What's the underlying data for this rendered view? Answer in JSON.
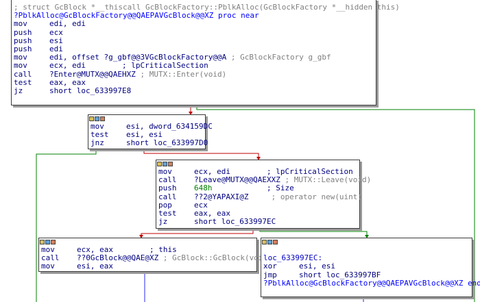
{
  "colors": {
    "edge_green": "#008000",
    "edge_red": "#c00000",
    "edge_blue": "#2a2af0",
    "node_border": "#3a3a3a"
  },
  "icons": [
    "color-icon",
    "graph-icon",
    "list-icon"
  ],
  "block1": {
    "header_comment": "; struct GcBlock *__thiscall GcBlockFactory::PblkAlloc(GcBlockFactory *__hidden this)",
    "proc_line": "?PblkAlloc@GcBlockFactory@@QAEPAVGcBlock@@XZ proc near",
    "lines": [
      {
        "m": "mov",
        "o": "edi, edi",
        "c": ""
      },
      {
        "m": "push",
        "o": "ecx",
        "c": ""
      },
      {
        "m": "push",
        "o": "esi",
        "c": ""
      },
      {
        "m": "push",
        "o": "edi",
        "c": ""
      },
      {
        "m": "mov",
        "o": "edi, offset ?g_gbf@@3VGcBlockFactory@@A",
        "c": " ; GcBlockFactory g_gbf"
      },
      {
        "m": "mov",
        "o": "ecx, edi        ; lpCriticalSection",
        "c": ""
      },
      {
        "m": "call",
        "o": "?Enter@MUTX@@QAEHXZ",
        "c": " ; MUTX::Enter(void)"
      },
      {
        "m": "test",
        "o": "eax, eax",
        "c": ""
      },
      {
        "m": "jz",
        "o": "short loc_633997E8",
        "c": ""
      }
    ]
  },
  "block2": {
    "lines": [
      {
        "m": "mov",
        "o": "esi, dword_634159DC"
      },
      {
        "m": "test",
        "o": "esi, esi"
      },
      {
        "m": "jnz",
        "o": "short loc_633997D0"
      }
    ]
  },
  "block3": {
    "lines": [
      {
        "m": "mov",
        "o": "ecx, edi        ; lpCriticalSection",
        "c": ""
      },
      {
        "m": "call",
        "o": "?Leave@MUTX@@QAEXXZ",
        "c": " ; MUTX::Leave(void)"
      },
      {
        "m": "push",
        "o": "648h",
        "tail": "            ; Size"
      },
      {
        "m": "call",
        "o": "??2@YAPAXI@Z",
        "c": "     ; operator new(uint)"
      },
      {
        "m": "pop",
        "o": "ecx",
        "c": ""
      },
      {
        "m": "test",
        "o": "eax, eax",
        "c": ""
      },
      {
        "m": "jz",
        "o": "short loc_633997EC",
        "c": ""
      }
    ]
  },
  "block4": {
    "lines": [
      {
        "m": "mov",
        "o": "ecx, eax        ; this",
        "c": ""
      },
      {
        "m": "call",
        "o": "??0GcBlock@@QAE@XZ",
        "c": " ; GcBlock::GcBlock(void)"
      },
      {
        "m": "mov",
        "o": "esi, eax",
        "c": ""
      }
    ]
  },
  "block5": {
    "label": "loc_633997EC:",
    "lines": [
      {
        "m": "xor",
        "o": "esi, esi"
      },
      {
        "m": "jmp",
        "o": "short loc_633997BF"
      }
    ],
    "endp_line": "?PblkAlloc@GcBlockFactory@@QAEPAVGcBlock@@XZ endp"
  }
}
